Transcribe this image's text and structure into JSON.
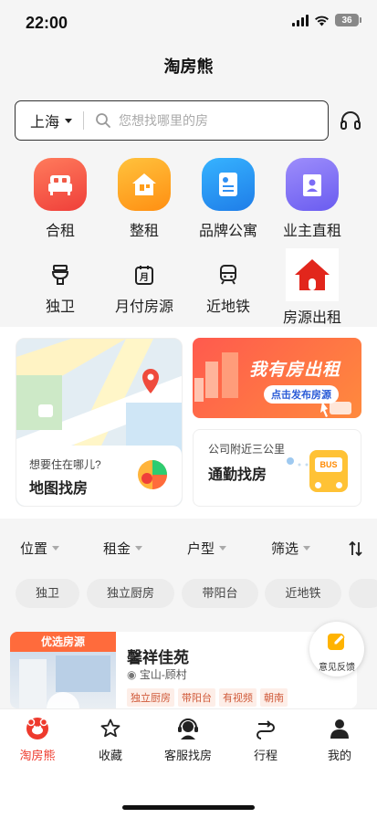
{
  "status": {
    "time": "22:00",
    "battery": "36"
  },
  "header": {
    "title": "淘房熊"
  },
  "search": {
    "city": "上海",
    "placeholder": "您想找哪里的房"
  },
  "categories_primary": [
    {
      "label": "合租",
      "icon": "bed-icon",
      "color": "#f05a47"
    },
    {
      "label": "整租",
      "icon": "house-icon",
      "color": "#ffa41c"
    },
    {
      "label": "品牌公寓",
      "icon": "document-icon",
      "color": "#2f8ff3"
    },
    {
      "label": "业主直租",
      "icon": "owner-building-icon",
      "color": "#7b6cf6"
    }
  ],
  "categories_secondary": [
    {
      "label": "独卫",
      "icon": "toilet-icon"
    },
    {
      "label": "月付房源",
      "icon": "calendar-month-icon",
      "badge": "月"
    },
    {
      "label": "近地铁",
      "icon": "subway-icon"
    },
    {
      "label": "房源出租",
      "icon": "red-house-icon"
    }
  ],
  "map_card": {
    "subtitle": "想要住在哪儿?",
    "title": "地图找房"
  },
  "promo_banner": {
    "headline": "我有房出租",
    "cta": "点击发布房源"
  },
  "commute_card": {
    "subtitle": "公司附近三公里",
    "title": "通勤找房",
    "bus_text": "BUS"
  },
  "filters": [
    "位置",
    "租金",
    "户型",
    "筛选"
  ],
  "quick_chips": [
    "独卫",
    "独立厨房",
    "带阳台",
    "近地铁"
  ],
  "listing": {
    "ribbon": "优选房源",
    "name": "馨祥佳苑",
    "location": "宝山-顾村",
    "tags": [
      "独立厨房",
      "带阳台",
      "有视频",
      "朝南"
    ]
  },
  "feedback": {
    "label": "意见反馈"
  },
  "tabbar": [
    {
      "label": "淘房熊",
      "icon": "bear-logo-icon",
      "active": true
    },
    {
      "label": "收藏",
      "icon": "star-icon",
      "active": false
    },
    {
      "label": "客服找房",
      "icon": "headset-agent-icon",
      "active": false
    },
    {
      "label": "行程",
      "icon": "route-icon",
      "active": false
    },
    {
      "label": "我的",
      "icon": "person-icon",
      "active": false
    }
  ],
  "colors": {
    "accent": "#ee3a2d",
    "page_bg": "#f5f5f5"
  }
}
